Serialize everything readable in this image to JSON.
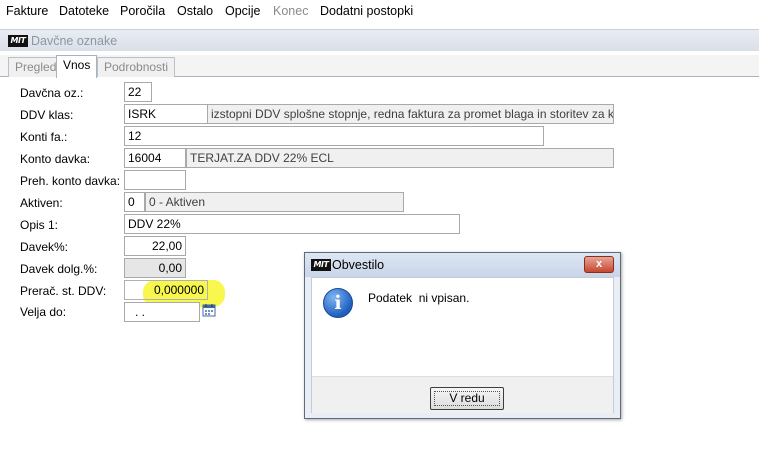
{
  "menu": {
    "items": [
      {
        "label": "Fakture",
        "disabled": false
      },
      {
        "label": "Datoteke",
        "disabled": false
      },
      {
        "label": "Poročila",
        "disabled": false
      },
      {
        "label": "Ostalo",
        "disabled": false
      },
      {
        "label": "Opcije",
        "disabled": false
      },
      {
        "label": "Konec",
        "disabled": true
      },
      {
        "label": "Dodatni postopki",
        "disabled": false
      }
    ]
  },
  "window": {
    "logo": "MIT",
    "title": "Davčne oznake"
  },
  "tabs": [
    {
      "label": "Pregled",
      "active": false
    },
    {
      "label": "Vnos",
      "active": true
    },
    {
      "label": "Podrobnosti",
      "active": false
    }
  ],
  "form": {
    "davcna_oz": {
      "label": "Davčna oz.:",
      "value": "22"
    },
    "ddv_klas": {
      "label": "DDV klas:",
      "value": "ISRK",
      "description": "izstopni DDV splošne stopnje, redna faktura za promet blaga in storitev za končne pc"
    },
    "konti_fa": {
      "label": "Konti fa.:",
      "value": "12"
    },
    "konto_davka": {
      "label": "Konto davka:",
      "value": "16004",
      "description": "TERJAT.ZA DDV 22% ECL"
    },
    "preh_konto_davka": {
      "label": "Preh. konto davka:",
      "value": ""
    },
    "aktiven": {
      "label": "Aktiven:",
      "value": "0",
      "description": "0 - Aktiven"
    },
    "opis1": {
      "label": "Opis 1:",
      "value": "DDV 22%"
    },
    "davek": {
      "label": "Davek%:",
      "value": "22,00"
    },
    "davek_dolg": {
      "label": "Davek dolg.%:",
      "value": "0,00"
    },
    "prerac_st_ddv": {
      "label": "Prerač. st. DDV:",
      "value": "0,000000"
    },
    "velja_do": {
      "label": "Velja do:",
      "value": ". ."
    }
  },
  "dialog": {
    "logo": "MIT",
    "title": "Obvestilo",
    "close_label": "x",
    "icon": "info-icon",
    "message": "Podatek  ni vpisan.",
    "ok_label": "V redu"
  },
  "colors": {
    "highlight": "#f6f62e",
    "close_button": "#c6472e",
    "info_icon": "#1e5fbf"
  }
}
